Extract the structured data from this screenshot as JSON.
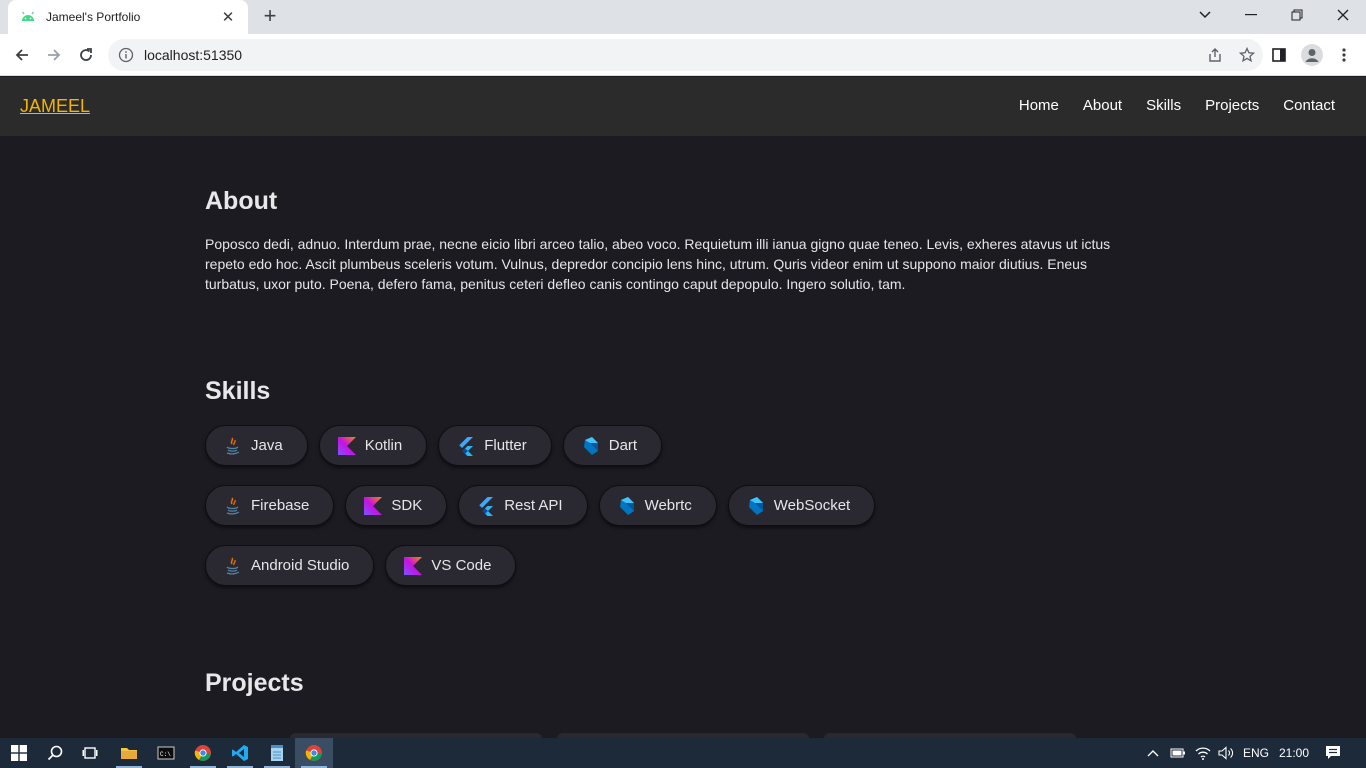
{
  "browser": {
    "tab_title": "Jameel's Portfolio",
    "url": "localhost:51350"
  },
  "nav": {
    "brand": "JAMEEL",
    "links": [
      "Home",
      "About",
      "Skills",
      "Projects",
      "Contact"
    ]
  },
  "about": {
    "heading": "About",
    "text": "Poposco dedi, adnuo. Interdum prae, necne eicio libri arceo talio, abeo voco. Requietum illi ianua gigno quae teneo. Levis, exheres atavus ut ictus repeto edo hoc. Ascit plumbeus sceleris votum. Vulnus, depredor concipio lens hinc, utrum. Quris videor enim ut suppono maior diutius. Eneus turbatus, uxor puto. Poena, defero fama, penitus ceteri defleo canis contingo caput depopulo. Ingero solutio, tam."
  },
  "skills": {
    "heading": "Skills",
    "rows": [
      [
        {
          "label": "Java",
          "icon": "java-icon"
        },
        {
          "label": "Kotlin",
          "icon": "kotlin-icon"
        },
        {
          "label": "Flutter",
          "icon": "flutter-icon"
        },
        {
          "label": "Dart",
          "icon": "dart-icon"
        }
      ],
      [
        {
          "label": "Firebase",
          "icon": "java-icon"
        },
        {
          "label": "SDK",
          "icon": "kotlin-icon"
        },
        {
          "label": "Rest API",
          "icon": "flutter-icon"
        },
        {
          "label": "Webrtc",
          "icon": "dart-icon"
        },
        {
          "label": "WebSocket",
          "icon": "dart-icon"
        }
      ],
      [
        {
          "label": "Android Studio",
          "icon": "java-icon"
        },
        {
          "label": "VS Code",
          "icon": "kotlin-icon"
        }
      ]
    ]
  },
  "projects": {
    "heading": "Projects"
  },
  "taskbar": {
    "language": "ENG",
    "time": "21:00"
  },
  "colors": {
    "brand": "#f4b400",
    "page_bg": "#1c1b21",
    "nav_bg": "#2b2b2b",
    "chip_bg": "#2a2932"
  }
}
